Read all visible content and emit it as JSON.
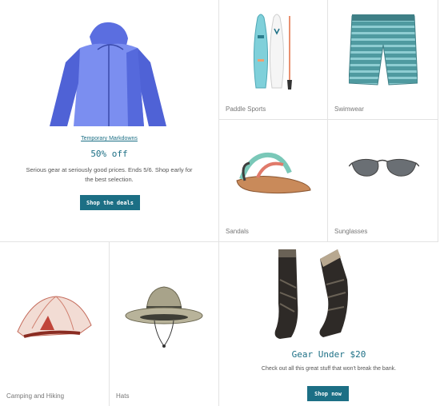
{
  "hero": {
    "promo_link": "Temporary Markdowns",
    "title": "50% off",
    "text": "Serious gear at seriously good prices. Ends 5/6. Shop early for the best selection.",
    "button": "Shop the deals",
    "image_icon": "jacket-icon"
  },
  "categories": {
    "paddle": {
      "label": "Paddle Sports",
      "icon": "paddleboard-icon"
    },
    "swim": {
      "label": "Swimwear",
      "icon": "boardshorts-icon"
    },
    "sandals": {
      "label": "Sandals",
      "icon": "sandal-icon"
    },
    "sunglasses": {
      "label": "Sunglasses",
      "icon": "sunglasses-icon"
    },
    "camping": {
      "label": "Camping and Hiking",
      "icon": "tent-icon"
    },
    "hats": {
      "label": "Hats",
      "icon": "sun-hat-icon"
    }
  },
  "deals": {
    "title": "Gear Under $20",
    "text": "Check out all this great stuff that won't break the bank.",
    "button": "Shop now",
    "image_icon": "socks-icon"
  },
  "colors": {
    "accent": "#1c6f85",
    "divider": "#e3e3e3"
  }
}
